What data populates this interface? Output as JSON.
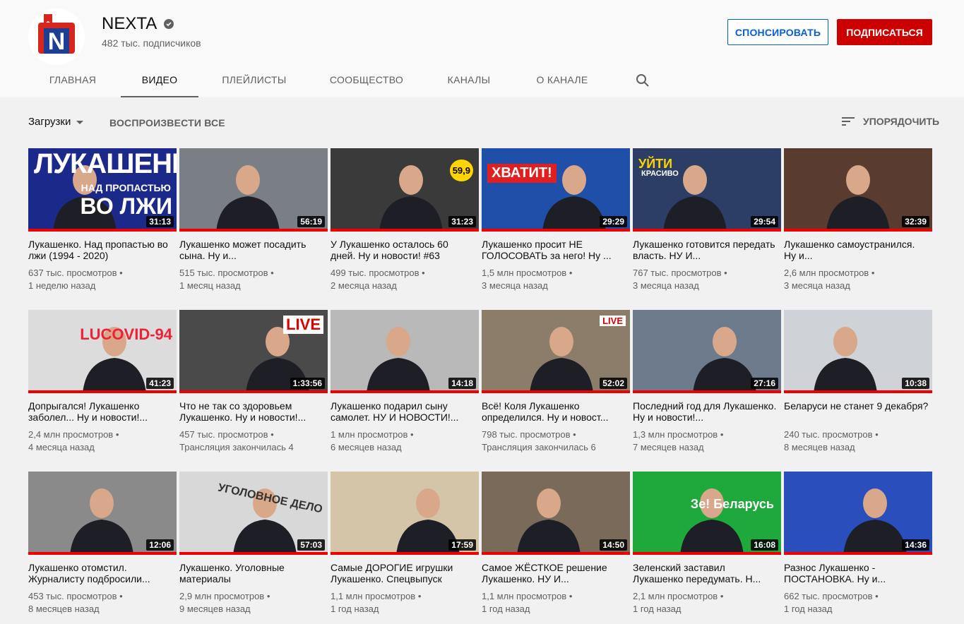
{
  "channel": {
    "name": "NEXTA",
    "subscribers": "482 тыс. подписчиков",
    "logo_letter": "N",
    "sponsor_label": "СПОНСИРОВАТЬ",
    "subscribe_label": "ПОДПИСАТЬСЯ",
    "verified_icon": "checkmark-badge-icon"
  },
  "tabs": [
    {
      "label": "ГЛАВНАЯ",
      "active": false
    },
    {
      "label": "ВИДЕО",
      "active": true
    },
    {
      "label": "ПЛЕЙЛИСТЫ",
      "active": false
    },
    {
      "label": "СООБЩЕСТВО",
      "active": false
    },
    {
      "label": "КАНАЛЫ",
      "active": false
    },
    {
      "label": "О КАНАЛЕ",
      "active": false
    }
  ],
  "toolbar": {
    "uploads_label": "Загрузки",
    "play_all_label": "ВОСПРОИЗВЕСТИ ВСЕ",
    "sort_label": "УПОРЯДОЧИТЬ"
  },
  "colors": {
    "accent_red": "#cc0000",
    "link_blue": "#065fd4",
    "progress_red": "#ee0000"
  },
  "videos": [
    {
      "title": "Лукашенко. Над пропастью во лжи (1994 - 2020)",
      "views": "637 тыс. просмотров",
      "age": "1 неделю назад",
      "duration": "31:13",
      "thumb_text": "ЛУКАШЕНКО",
      "thumb_text2": "НАД ПРОПАСТЬЮ",
      "thumb_text3": "ВО ЛЖИ",
      "color": "#1b2a8a"
    },
    {
      "title": "Лукашенко может посадить сына. Ну и...",
      "views": "515 тыс. просмотров",
      "age": "1 месяц назад",
      "duration": "56:19",
      "color": "#7a7f86"
    },
    {
      "title": "У Лукашенко осталось 60 дней. Ну и новости! #63",
      "views": "499 тыс. просмотров",
      "age": "2 месяца назад",
      "duration": "31:23",
      "thumb_text": "59,9",
      "color": "#3a3a3a"
    },
    {
      "title": "Лукашенко просит НЕ ГОЛОСОВАТЬ за него! Ну ...",
      "views": "1,5 млн просмотров",
      "age": "3 месяца назад",
      "duration": "29:29",
      "thumb_text": "ХВАТИТ!",
      "color": "#1f4fa8"
    },
    {
      "title": "Лукашенко готовится передать власть. НУ И...",
      "views": "767 тыс. просмотров",
      "age": "3 месяца назад",
      "duration": "29:54",
      "thumb_text": "УЙТИ",
      "thumb_text2": "КРАСИВО",
      "color": "#2c3e66"
    },
    {
      "title": "Лукашенко самоустранился. Ну и...",
      "views": "2,6 млн просмотров",
      "age": "3 месяца назад",
      "duration": "32:39",
      "color": "#5a3b30"
    },
    {
      "title": "Допрыгался! Лукашенко заболел... Ну и новости!...",
      "views": "2,4 млн просмотров",
      "age": "4 месяца назад",
      "duration": "41:23",
      "thumb_text": "LUCOVID-94",
      "color": "#dcdcdc"
    },
    {
      "title": "Что не так со здоровьем Лукашенко. Ну и новости!...",
      "views": "457 тыс. просмотров",
      "age": "Трансляция закончилась 4",
      "duration": "1:33:56",
      "thumb_text": "LIVE",
      "color": "#4a4a4a"
    },
    {
      "title": "Лукашенко подарил сыну самолет. НУ И НОВОСТИ!...",
      "views": "1 млн просмотров",
      "age": "6 месяцев назад",
      "duration": "14:18",
      "color": "#b9b9b9"
    },
    {
      "title": "Всё! Коля Лукашенко определился. Ну и новост...",
      "views": "798 тыс. просмотров",
      "age": "Трансляция закончилась 6",
      "duration": "52:02",
      "thumb_text": "LIVE",
      "color": "#8c7d6a"
    },
    {
      "title": "Последний год для Лукашенко. Ну и новости!...",
      "views": "1,3 млн просмотров",
      "age": "7 месяцев назад",
      "duration": "27:16",
      "color": "#6d7b8c"
    },
    {
      "title": "Беларуси не станет 9 декабря?",
      "views": "240 тыс. просмотров",
      "age": "8 месяцев назад",
      "duration": "10:38",
      "color": "#cfd2d6"
    },
    {
      "title": "Лукашенко отомстил. Журналисту подбросили...",
      "views": "453 тыс. просмотров",
      "age": "8 месяцев назад",
      "duration": "12:06",
      "color": "#8a8a8a"
    },
    {
      "title": "Лукашенко. Уголовные материалы",
      "views": "2,9 млн просмотров",
      "age": "9 месяцев назад",
      "duration": "57:03",
      "thumb_text": "УГОЛОВНОЕ ДЕЛО",
      "color": "#d8d8d8"
    },
    {
      "title": "Самые ДОРОГИЕ игрушки Лукашенко. Спецвыпуск",
      "views": "1,1 млн просмотров",
      "age": "1 год назад",
      "duration": "17:59",
      "color": "#d4c4a8"
    },
    {
      "title": "Самое ЖЁСТКОЕ решение Лукашенко. НУ И...",
      "views": "1,1 млн просмотров",
      "age": "1 год назад",
      "duration": "14:50",
      "color": "#7a6a5a"
    },
    {
      "title": "Зеленский заставил Лукашенко передумать. Н...",
      "views": "2,1 млн просмотров",
      "age": "1 год назад",
      "duration": "16:08",
      "thumb_text": "Зе! Беларусь",
      "color": "#1fa83c"
    },
    {
      "title": "Разнос Лукашенко - ПОСТАНОВКА. Ну и...",
      "views": "662 тыс. просмотров",
      "age": "1 год назад",
      "duration": "14:36",
      "color": "#2a4fbd"
    }
  ]
}
